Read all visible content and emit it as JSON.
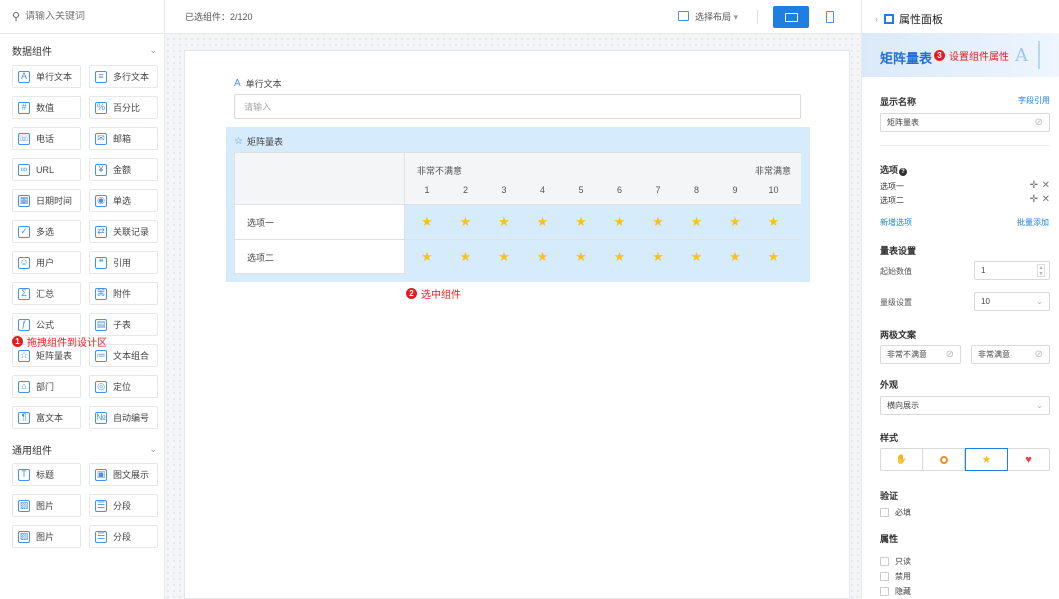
{
  "left_panel": {
    "search_placeholder": "请输入关键词",
    "section_data": "数据组件",
    "section_common": "通用组件",
    "data_items": [
      {
        "label": "单行文本",
        "icon": "text-a-icon"
      },
      {
        "label": "多行文本",
        "icon": "multiline-text-icon"
      },
      {
        "label": "数值",
        "icon": "number-icon"
      },
      {
        "label": "百分比",
        "icon": "percent-icon"
      },
      {
        "label": "电话",
        "icon": "phone-icon"
      },
      {
        "label": "邮箱",
        "icon": "mail-icon"
      },
      {
        "label": "URL",
        "icon": "link-icon"
      },
      {
        "label": "金额",
        "icon": "money-icon"
      },
      {
        "label": "日期时间",
        "icon": "calendar-icon"
      },
      {
        "label": "单选",
        "icon": "radio-icon"
      },
      {
        "label": "多选",
        "icon": "checkbox-icon"
      },
      {
        "label": "关联记录",
        "icon": "relation-icon"
      },
      {
        "label": "用户",
        "icon": "user-icon"
      },
      {
        "label": "引用",
        "icon": "quote-icon"
      },
      {
        "label": "汇总",
        "icon": "summary-icon"
      },
      {
        "label": "附件",
        "icon": "attachment-icon"
      },
      {
        "label": "公式",
        "icon": "formula-icon"
      },
      {
        "label": "子表",
        "icon": "subtable-icon"
      },
      {
        "label": "矩阵量表",
        "icon": "matrix-scale-icon"
      },
      {
        "label": "文本组合",
        "icon": "text-combine-icon"
      },
      {
        "label": "部门",
        "icon": "department-icon"
      },
      {
        "label": "定位",
        "icon": "location-icon"
      },
      {
        "label": "富文本",
        "icon": "rich-text-icon"
      },
      {
        "label": "自动编号",
        "icon": "auto-number-icon"
      }
    ],
    "common_items": [
      {
        "label": "标题",
        "icon": "title-icon"
      },
      {
        "label": "图文展示",
        "icon": "image-text-icon"
      },
      {
        "label": "图片",
        "icon": "image-icon"
      },
      {
        "label": "分段",
        "icon": "section-icon"
      },
      {
        "label": "图片",
        "icon": "image-icon"
      },
      {
        "label": "分段",
        "icon": "section-icon"
      }
    ],
    "note1_num": "1",
    "note1_text": "拖拽组件到设计区"
  },
  "topbar": {
    "selected_count": "已选组件：2/120",
    "layout_label": "选择布局",
    "layout_caret": "▾"
  },
  "canvas": {
    "field1_label": "单行文本",
    "field1_placeholder": "请输入",
    "matrix_title": "矩阵量表",
    "low_text": "非常不满意",
    "high_text": "非常满意",
    "scale": [
      "1",
      "2",
      "3",
      "4",
      "5",
      "6",
      "7",
      "8",
      "9",
      "10"
    ],
    "rows": [
      "选项一",
      "选项二"
    ],
    "note2_num": "2",
    "note2_text": "选中组件"
  },
  "right_panel": {
    "header": "属性面板",
    "banner_title": "矩阵量表",
    "note3_num": "3",
    "note3_text": "设置组件属性",
    "display_name_label": "显示名称",
    "field_ref_link": "字段引用",
    "display_name_value": "矩阵量表",
    "options_label": "选项",
    "options": [
      "选项一",
      "选项二"
    ],
    "add_option": "新增选项",
    "bulk_add": "批量添加",
    "scale_settings_label": "量表设置",
    "start_value_label": "起始数值",
    "start_value": "1",
    "levels_label": "量级设置",
    "levels_value": "10",
    "end_text_label": "两极文案",
    "end_text_low": "非常不满意",
    "end_text_high": "非常满意",
    "appearance_label": "外观",
    "appearance_value": "横向展示",
    "style_label": "样式",
    "validate_label": "验证",
    "required_label": "必填",
    "property_label": "属性",
    "readonly_label": "只读",
    "disabled_label": "禁用",
    "hidden_label": "隐藏"
  },
  "colors": {
    "accent": "#1f7fe0",
    "red": "#e02020",
    "star": "#f7c21a",
    "selected_bg": "#d6ebfb"
  }
}
